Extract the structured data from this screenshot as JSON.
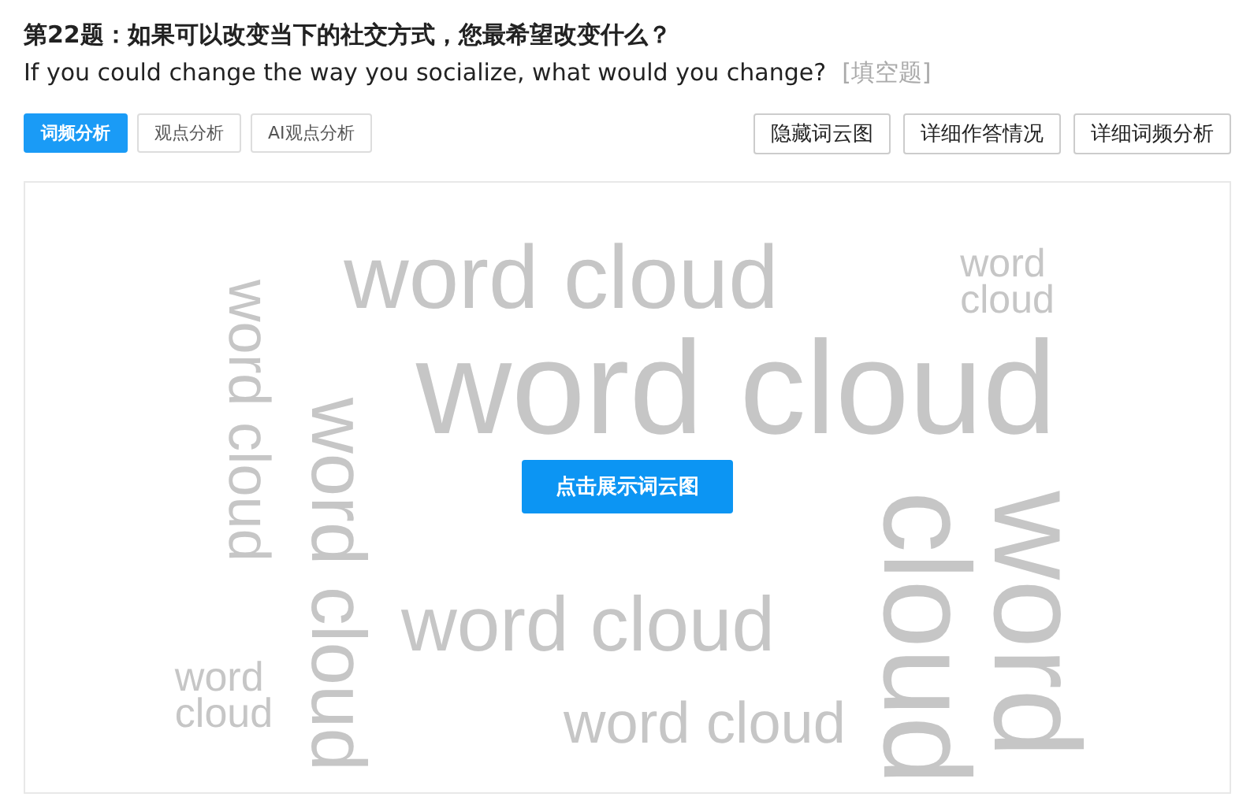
{
  "question": {
    "title": "第22题：如果可以改变当下的社交方式，您最希望改变什么？",
    "subtitle": "If you could change the way you socialize, what would you change?",
    "type_tag": "[填空题]"
  },
  "tabs": [
    {
      "label": "词频分析",
      "selected": true
    },
    {
      "label": "观点分析",
      "selected": false
    },
    {
      "label": "AI观点分析",
      "selected": false
    }
  ],
  "actions": [
    "隐藏词云图",
    "详细作答情况",
    "详细词频分析"
  ],
  "word_cloud": {
    "words": [
      {
        "text": "word cloud",
        "kind": "horizontal"
      },
      {
        "text": "word cloud",
        "kind": "horizontal"
      },
      {
        "text": "word cloud",
        "kind": "horizontal"
      },
      {
        "text": "word cloud",
        "kind": "vertical"
      },
      {
        "text": "word cloud",
        "kind": "vertical"
      },
      {
        "text": "word cloud",
        "kind": "horizontal"
      },
      {
        "text": "word cloud",
        "kind": "horizontal"
      },
      {
        "text": "word cloud",
        "kind": "horizontal"
      },
      {
        "text": "word cloud",
        "kind": "vertical"
      }
    ],
    "button": "点击展示词云图"
  }
}
